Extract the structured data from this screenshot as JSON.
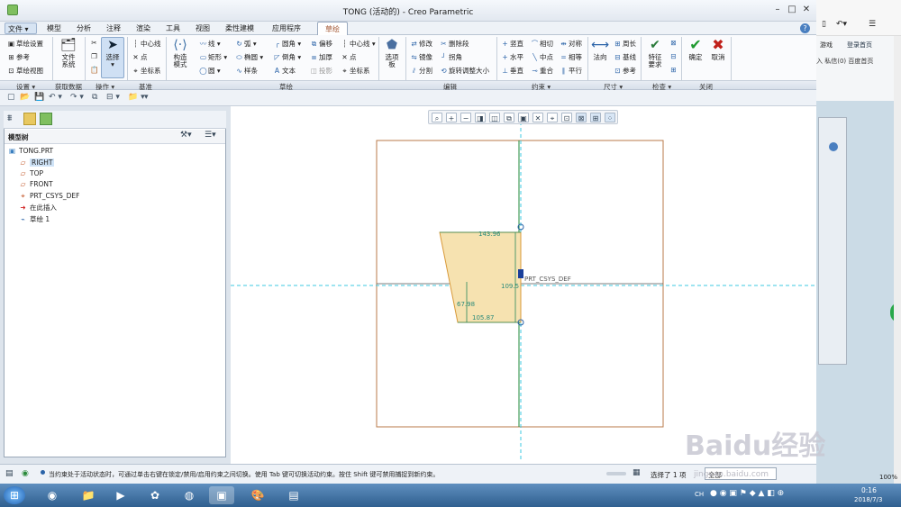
{
  "window": {
    "title": "TONG (活动的) - Creo Parametric"
  },
  "menu": [
    "文件",
    "模型",
    "分析",
    "注释",
    "渲染",
    "工具",
    "视图",
    "柔性建模",
    "应用程序",
    "草绘"
  ],
  "ribbon": {
    "setup": {
      "items": [
        "草绘设置",
        "参考",
        "草绘视图"
      ]
    },
    "get_data": {
      "label1": "文件",
      "label2": "系统"
    },
    "ops": {
      "select": "选择"
    },
    "datum": {
      "items": [
        "中心线",
        "点",
        "坐标系"
      ]
    },
    "sketch": {
      "construct1": "构造",
      "construct2": "模式",
      "items": [
        "线",
        "弧",
        "圆角",
        "偏移",
        "中心线",
        "矩形",
        "椭圆",
        "倒角",
        "加厚",
        "点",
        "圆",
        "样条",
        "文本",
        "投影",
        "坐标系"
      ]
    },
    "palette": {
      "label1": "选项",
      "label2": "板"
    },
    "edit": {
      "items": [
        "修改",
        "删除段",
        "镜像",
        "拐角",
        "分割",
        "旋转调整大小"
      ]
    },
    "constrain": {
      "items": [
        "竖直",
        "相切",
        "对称",
        "水平",
        "中点",
        "相等",
        "垂直",
        "重合",
        "平行"
      ]
    },
    "dim": {
      "normal": "法向",
      "items": [
        "周长",
        "基线",
        "参考"
      ]
    },
    "inspect": {
      "label1": "特征",
      "label2": "要求"
    },
    "close": {
      "ok": "确定",
      "cancel": "取消"
    },
    "groups": [
      "设置",
      "获取数据",
      "操作",
      "基准",
      "草绘",
      "编辑",
      "约束",
      "尺寸",
      "检查",
      "关闭"
    ]
  },
  "model_tree": {
    "header": "模型树",
    "items": [
      "TONG.PRT",
      "RIGHT",
      "TOP",
      "FRONT",
      "PRT_CSYS_DEF",
      "在此插入",
      "草绘 1"
    ]
  },
  "sketch": {
    "csys_label": "PRT_CSYS_DEF",
    "dimensions": [
      "143.96",
      "109.5",
      "67.98",
      "105.87"
    ]
  },
  "status": {
    "message": "当约束处于活动状态时，可通过单击右键在锁定/禁用/启用约束之间切换。使用 Tab 键可切换活动约束。按住 Shift 键可禁用捕捉到新约束。",
    "selected": "选择了 1 项",
    "filter": "全部"
  },
  "browser": {
    "tab1": "游戏",
    "login": "登录首页",
    "line2": "入  私信(0)  百度首页"
  },
  "tray": {
    "time": "0:16",
    "date": "2018/7/3",
    "ime": "CH",
    "zoom": "100%"
  },
  "watermark": "Baidu经验",
  "watermark_url": "jingyan.baidu.com"
}
